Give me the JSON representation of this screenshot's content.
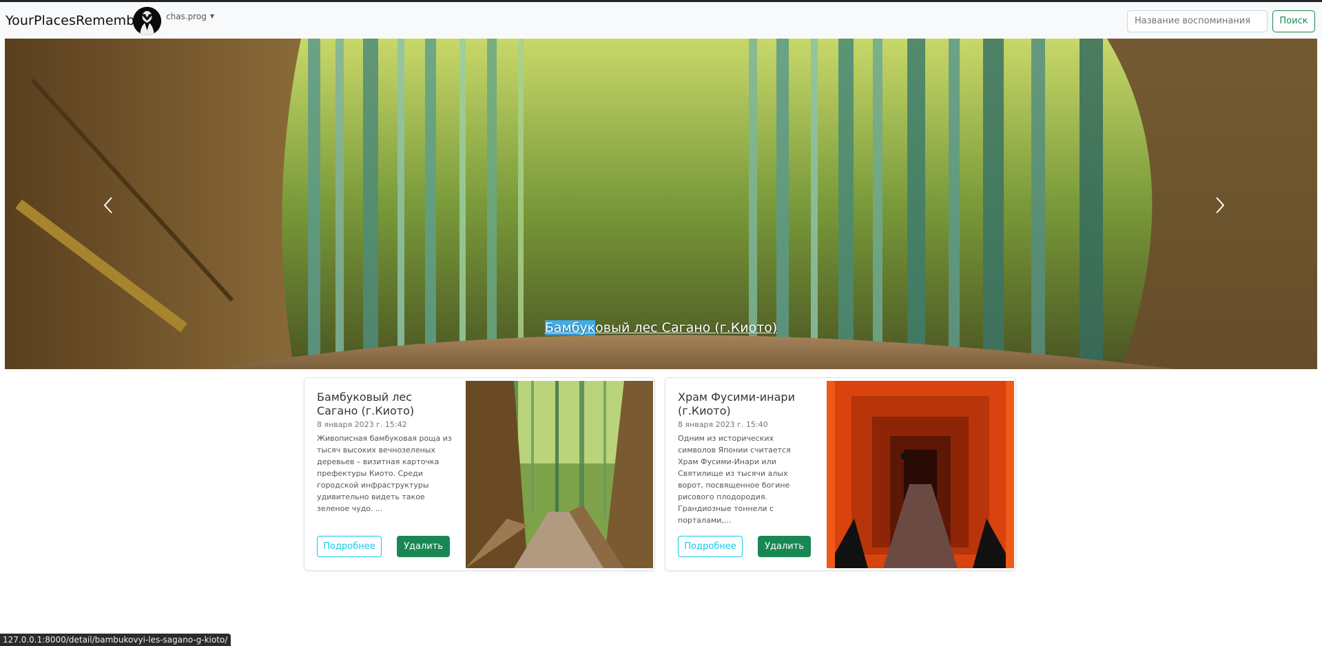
{
  "navbar": {
    "brand": "YourPlacesRemember",
    "username": "chas.prog",
    "search_placeholder": "Название воспоминания",
    "search_button": "Поиск"
  },
  "carousel": {
    "caption_highlighted": "Бамбук",
    "caption_rest": "овый лес Сагано (г.Киото)"
  },
  "cards": [
    {
      "title": "Бамбуковый лес Сагано (г.Киото)",
      "date": "8 января 2023 г. 15:42",
      "text": "Живописная бамбуковая роща из тысяч высоких вечнозеленых деревьев – визитная карточка префектуры Киото. Среди городской инфраструктуры удивительно видеть такое зеленое чудо. ...",
      "more_label": "Подробнее",
      "delete_label": "Удалить"
    },
    {
      "title": "Храм Фусими-инари (г.Киото)",
      "date": "8 января 2023 г. 15:40",
      "text": "Одним из исторических символов Японии считается Храм Фусими-Инари или Святилище из тысячи алых ворот, посвященное богине рисового плодородия. Грандиозные тоннели с порталами,...",
      "more_label": "Подробнее",
      "delete_label": "Удалить"
    }
  ],
  "statusbar": {
    "url": "127.0.0.1:8000/detail/bambukovyi-les-sagano-g-kioto/"
  },
  "colors": {
    "success": "#198754",
    "info": "#0dcaf0",
    "navbar_bg": "#f8f9fa"
  }
}
